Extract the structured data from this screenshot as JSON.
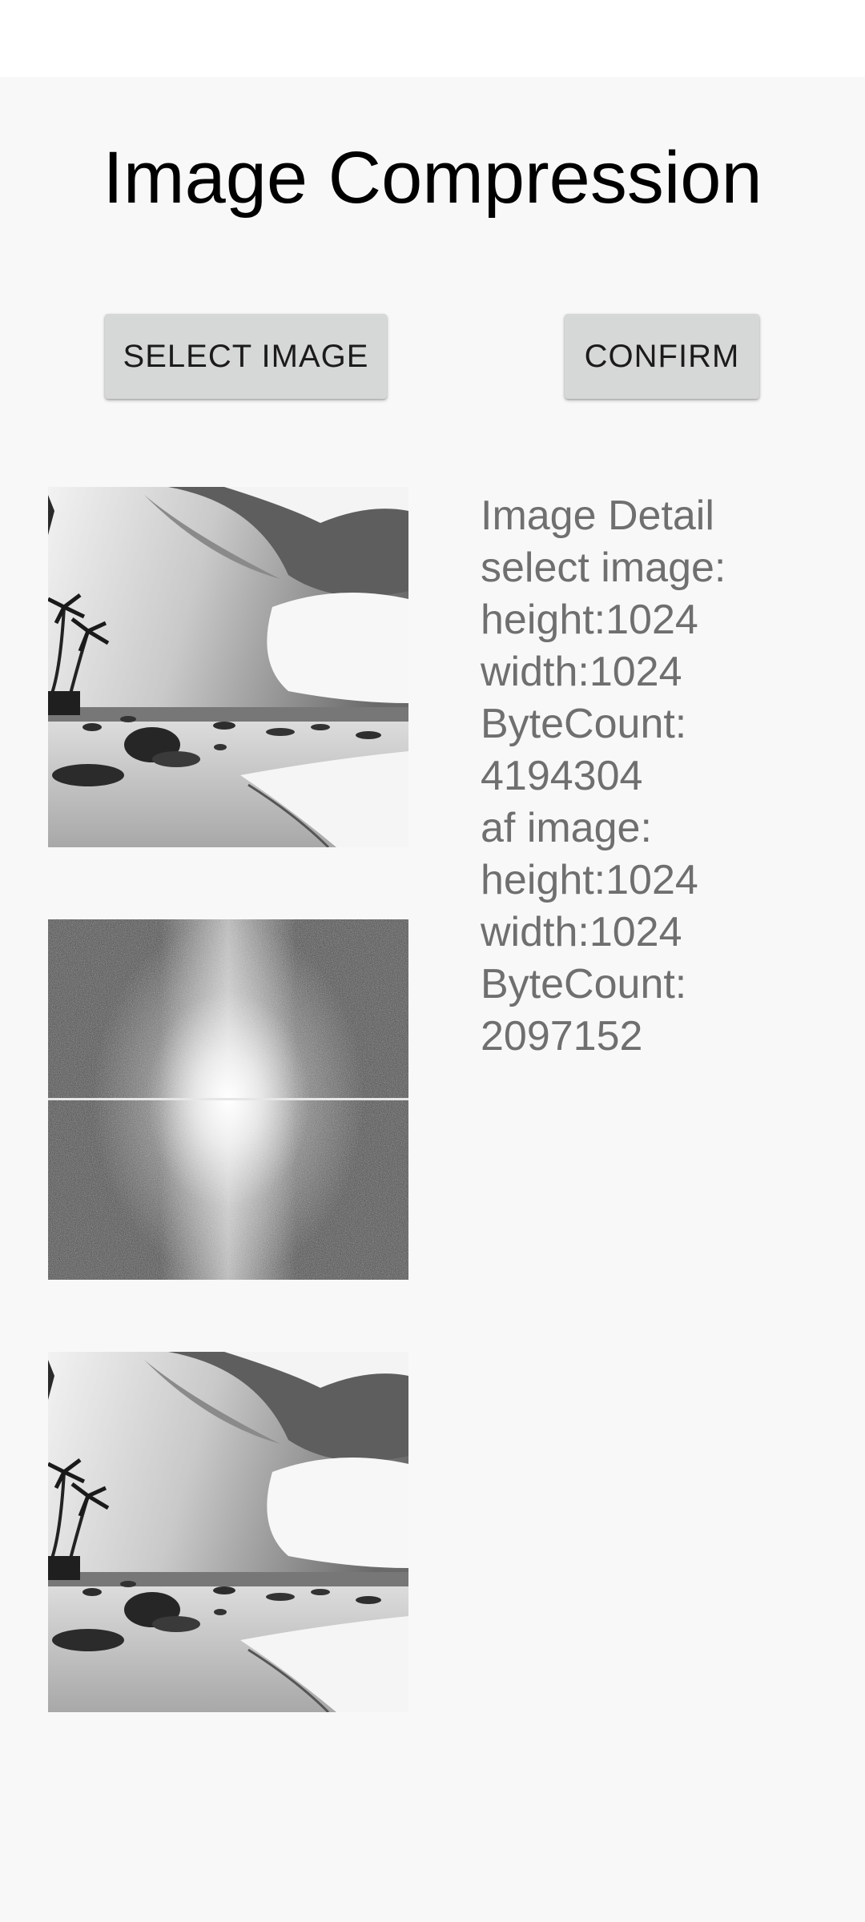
{
  "app": {
    "title": "Image Compression"
  },
  "toolbar": {
    "select_label": "SELECT IMAGE",
    "confirm_label": "CONFIRM"
  },
  "images": [
    {
      "name": "selected-image",
      "kind": "grayscale-beach-photo"
    },
    {
      "name": "frequency-spectrum-image",
      "kind": "fft-magnitude-spectrum"
    },
    {
      "name": "compressed-image",
      "kind": "grayscale-beach-photo"
    }
  ],
  "details": {
    "lines": [
      "Image Detail",
      "select image:",
      "height:1024",
      "width:1024",
      "ByteCount:",
      "4194304",
      "af image:",
      "height:1024",
      "width:1024",
      "ByteCount:",
      "2097152"
    ]
  },
  "colors": {
    "background": "#f8f8f8",
    "button": "#d6d7d7",
    "detail_text": "#6f6f6f"
  }
}
